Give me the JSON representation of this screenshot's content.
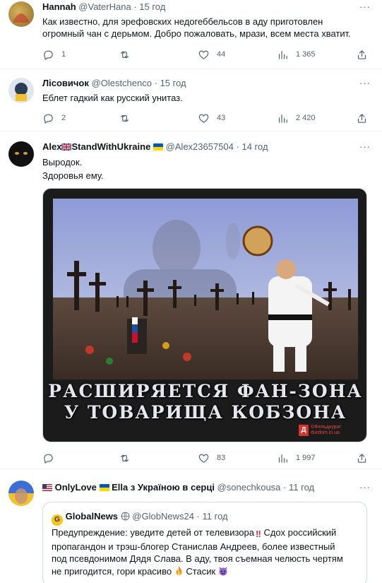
{
  "tweets": [
    {
      "name": "Hannah",
      "handle": "@VaterHana",
      "time": "15 год",
      "text_lines": [
        "Как известно, для эрефовских недогеббельсов в аду приготовлен",
        "огромный чан с дерьмом. Добро пожаловать, мрази, всем места хватит."
      ],
      "replies": "1",
      "retweets": "",
      "likes": "44",
      "views": "1 365"
    },
    {
      "name": "Лісовичок",
      "handle": "@Olestchenco",
      "time": "15 год",
      "text_lines": [
        "Еблет гадкий как русский унитаз."
      ],
      "replies": "2",
      "retweets": "",
      "likes": "43",
      "views": "2 420"
    },
    {
      "name_a": "Alex",
      "name_b": "StandWithUkraine",
      "handle": "@Alex23657504",
      "time": "14 год",
      "text_lines": [
        "Выродок.",
        "Здоровья ему."
      ],
      "media": {
        "caption_line1": "РАСШИРЯЕТСЯ ФАН-ЗОНА",
        "caption_line2": "У ТОВАРИЩА КОБЗОНА",
        "watermark1": "©Фельдкурат",
        "watermark2": "durdom.in.ua"
      },
      "replies": "",
      "retweets": "",
      "likes": "83",
      "views": "1 997"
    },
    {
      "name": "OnlyLove",
      "name_extra": "Ella з Україною в серці",
      "handle": "@sonechkousa",
      "time": "11 год",
      "quote": {
        "name": "GlobalNews",
        "handle": "@GlobNews24",
        "time": "11 год",
        "line1": "Предупреждение: уведите детей от телевизора",
        "line2": "Сдох российский",
        "line3": "пропагандон и трэш-блогер Станислав Андреев, более известный",
        "line4": "под псевдонимом Дядя Слава. В аду, твоя съемная челюсть чертям",
        "line5": "не пригодится, гори красиво",
        "line6": "Стасик"
      }
    }
  ],
  "ui": {
    "dot": "·",
    "more": "···"
  },
  "colors": {
    "text": "#0f1419",
    "muted": "#536471",
    "border": "#eff3f4",
    "verified": "#1d9bf0"
  }
}
